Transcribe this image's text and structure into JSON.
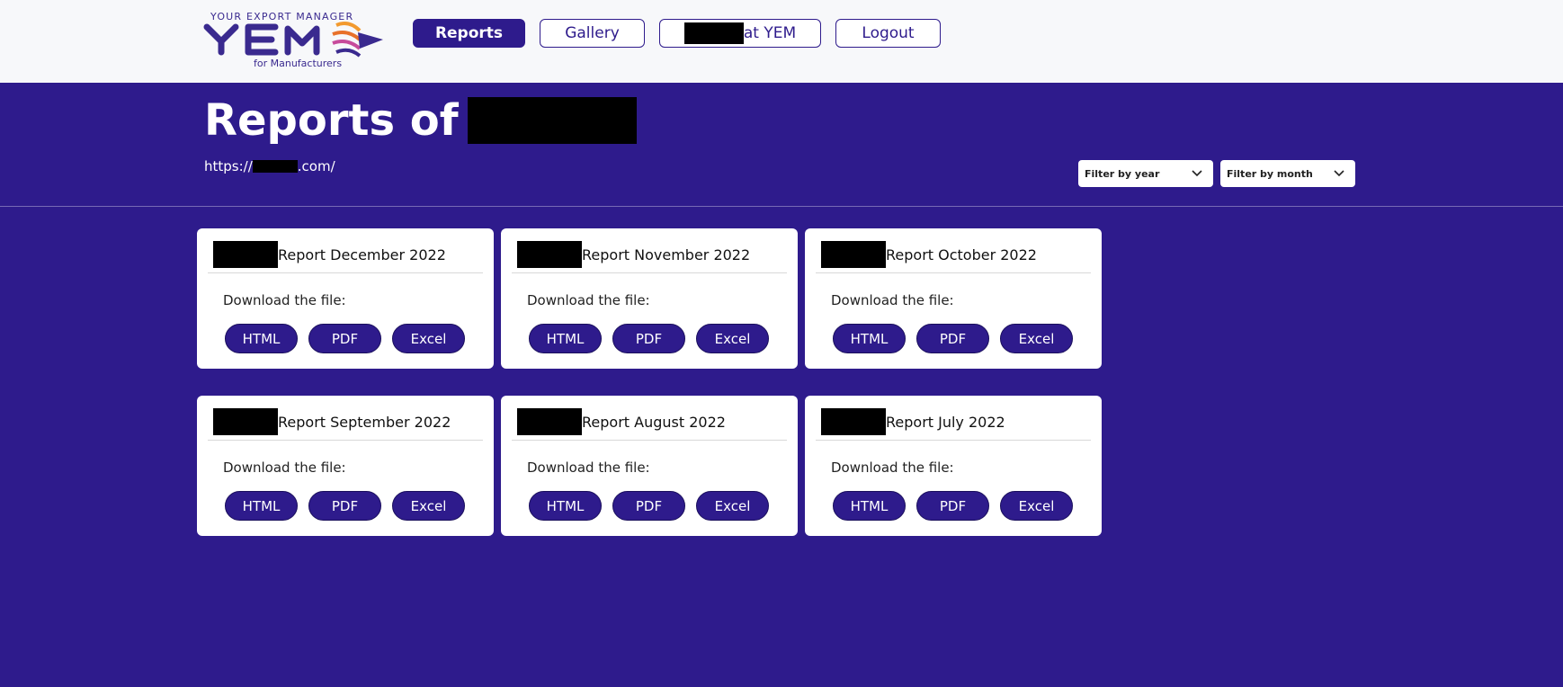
{
  "brand": {
    "tagline": "YOUR EXPORT MANAGER",
    "name": "YEM",
    "subtitle": "for Manufacturers",
    "primary_color": "#2e1b8c",
    "accent_color": "#f29a2e"
  },
  "nav": {
    "reports": "Reports",
    "gallery": "Gallery",
    "at_yem": "at YEM",
    "logout": "Logout"
  },
  "page": {
    "title_prefix": "Reports of",
    "url_prefix": "https://",
    "url_suffix": ".com/"
  },
  "filters": {
    "year": "Filter by year",
    "month": "Filter by month"
  },
  "cards": [
    {
      "title": "Report December 2022",
      "subtitle": "Download the file:",
      "buttons": [
        "HTML",
        "PDF",
        "Excel"
      ]
    },
    {
      "title": "Report November 2022",
      "subtitle": "Download the file:",
      "buttons": [
        "HTML",
        "PDF",
        "Excel"
      ]
    },
    {
      "title": "Report October 2022",
      "subtitle": "Download the file:",
      "buttons": [
        "HTML",
        "PDF",
        "Excel"
      ]
    },
    {
      "title": "Report September 2022",
      "subtitle": "Download the file:",
      "buttons": [
        "HTML",
        "PDF",
        "Excel"
      ]
    },
    {
      "title": "Report August 2022",
      "subtitle": "Download the file:",
      "buttons": [
        "HTML",
        "PDF",
        "Excel"
      ]
    },
    {
      "title": "Report July 2022",
      "subtitle": "Download the file:",
      "buttons": [
        "HTML",
        "PDF",
        "Excel"
      ]
    }
  ]
}
